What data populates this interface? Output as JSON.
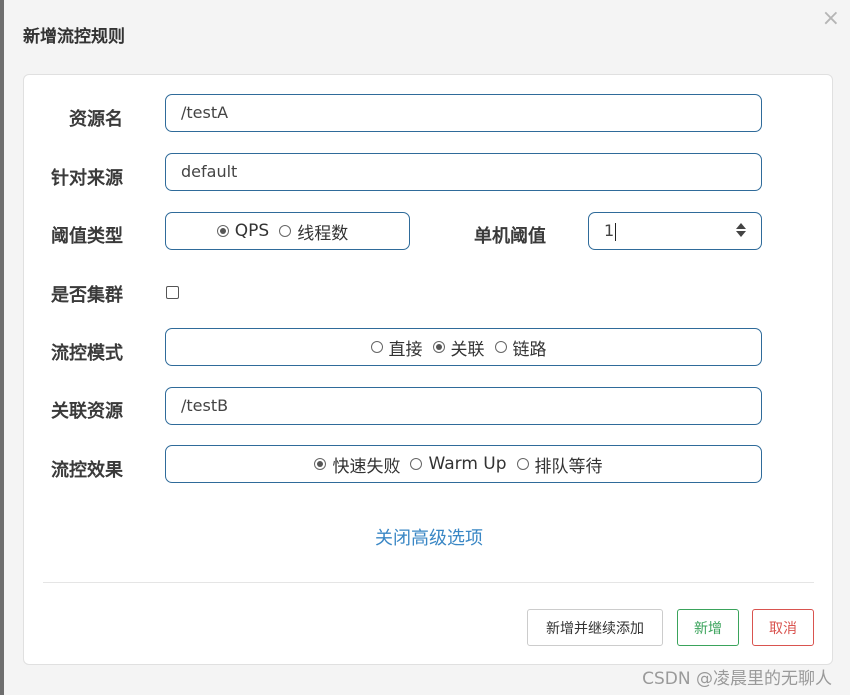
{
  "dialog": {
    "title": "新增流控规则",
    "close_symbol": "×"
  },
  "form": {
    "resource": {
      "label": "资源名",
      "value": "/testA"
    },
    "limit_app": {
      "label": "针对来源",
      "value": "default"
    },
    "threshold_type": {
      "label": "阈值类型",
      "options": [
        "QPS",
        "线程数"
      ],
      "selected": "QPS"
    },
    "single_threshold": {
      "label": "单机阈值",
      "value": "1"
    },
    "cluster": {
      "label": "是否集群",
      "checked": false
    },
    "flow_mode": {
      "label": "流控模式",
      "options": [
        "直接",
        "关联",
        "链路"
      ],
      "selected": "关联"
    },
    "ref_resource": {
      "label": "关联资源",
      "value": "/testB"
    },
    "control_effect": {
      "label": "流控效果",
      "options": [
        "快速失败",
        "Warm Up",
        "排队等待"
      ],
      "selected": "快速失败"
    },
    "advanced_toggle": "关闭高级选项"
  },
  "footer": {
    "save_and_continue": "新增并继续添加",
    "save": "新增",
    "cancel": "取消"
  },
  "watermark": "CSDN @凌晨里的无聊人"
}
